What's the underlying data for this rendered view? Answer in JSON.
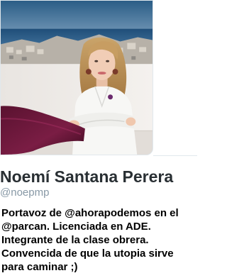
{
  "profile": {
    "photo_alt": "Profile photo",
    "display_name": "Noemí Santana Perera",
    "screen_name": "@noepmp",
    "bio_lines": [
      "Portavoz de @ahorapodemos en el",
      "@parcan. Licenciada en ADE.",
      "Integrante de la clase obrera.",
      "Convencida de que la utopia sirve",
      "para caminar ;)"
    ]
  },
  "colors": {
    "name_text": "#292f33",
    "handle_text": "#8899a6",
    "bio_text": "#000000",
    "border": "#e1e8ed"
  }
}
